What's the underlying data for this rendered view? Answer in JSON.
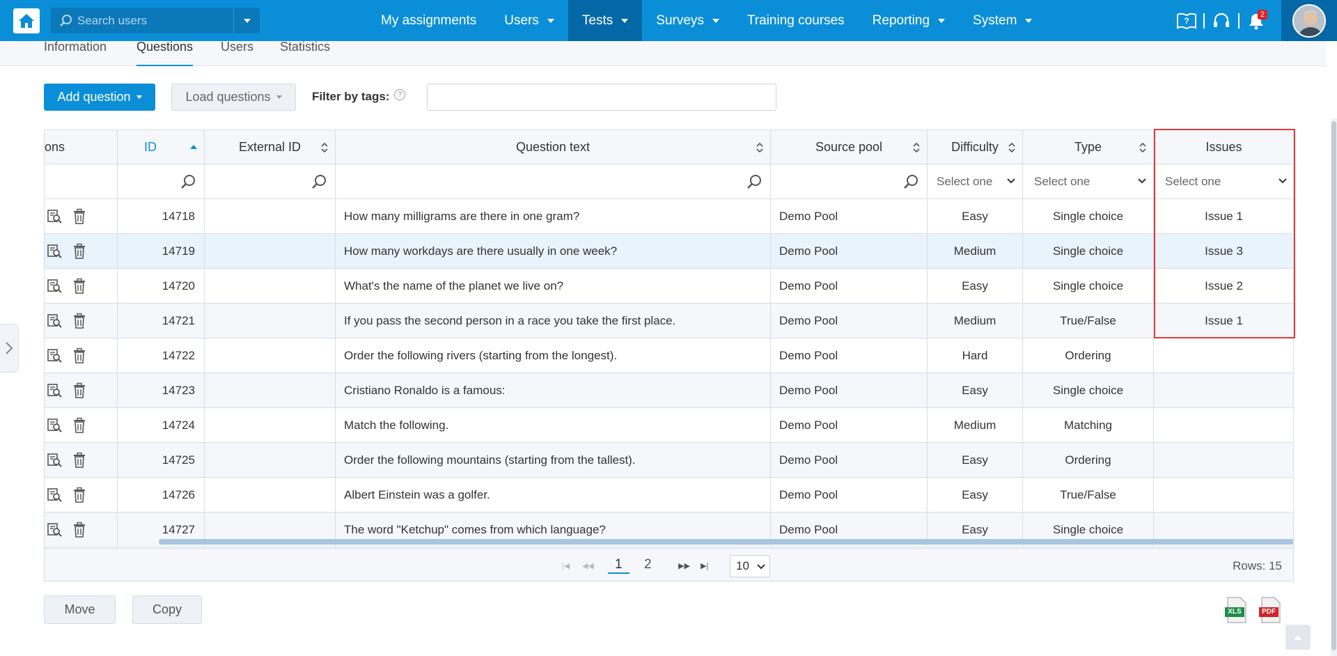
{
  "nav": {
    "search_placeholder": "Search users",
    "items": [
      {
        "label": "My assignments",
        "has_caret": false,
        "active": false
      },
      {
        "label": "Users",
        "has_caret": true,
        "active": false
      },
      {
        "label": "Tests",
        "has_caret": true,
        "active": true
      },
      {
        "label": "Surveys",
        "has_caret": true,
        "active": false
      },
      {
        "label": "Training courses",
        "has_caret": false,
        "active": false
      },
      {
        "label": "Reporting",
        "has_caret": true,
        "active": false
      },
      {
        "label": "System",
        "has_caret": true,
        "active": false
      }
    ],
    "notification_count": "2",
    "brand_color": "#0b8ed8"
  },
  "tabs": {
    "information": "Information",
    "questions": "Questions",
    "users": "Users",
    "statistics": "Statistics"
  },
  "toolbar": {
    "add_question": "Add question",
    "load_questions": "Load questions",
    "filter_label": "Filter by tags:",
    "help_glyph": "?"
  },
  "table": {
    "headers": {
      "actions": "ons",
      "id": "ID",
      "external_id": "External ID",
      "question_text": "Question text",
      "source_pool": "Source pool",
      "difficulty": "Difficulty",
      "type": "Type",
      "issues": "Issues"
    },
    "filters": {
      "difficulty": "Select one",
      "type": "Select one",
      "issues": "Select one"
    },
    "rows": [
      {
        "id": "14718",
        "external_id": "",
        "text": "How many milligrams are there in one gram?",
        "pool": "Demo Pool",
        "difficulty": "Easy",
        "type": "Single choice",
        "issue": "Issue 1"
      },
      {
        "id": "14719",
        "external_id": "",
        "text": "How many workdays are there usually in one week?",
        "pool": "Demo Pool",
        "difficulty": "Medium",
        "type": "Single choice",
        "issue": "Issue 3"
      },
      {
        "id": "14720",
        "external_id": "",
        "text": "What's the name of the planet we live on?",
        "pool": "Demo Pool",
        "difficulty": "Easy",
        "type": "Single choice",
        "issue": "Issue 2"
      },
      {
        "id": "14721",
        "external_id": "",
        "text": "If you pass the second person in a race you take the first place.",
        "pool": "Demo Pool",
        "difficulty": "Medium",
        "type": "True/False",
        "issue": "Issue 1"
      },
      {
        "id": "14722",
        "external_id": "",
        "text": "Order the following rivers (starting from the longest).",
        "pool": "Demo Pool",
        "difficulty": "Hard",
        "type": "Ordering",
        "issue": ""
      },
      {
        "id": "14723",
        "external_id": "",
        "text": "Cristiano Ronaldo is a famous:",
        "pool": "Demo Pool",
        "difficulty": "Easy",
        "type": "Single choice",
        "issue": ""
      },
      {
        "id": "14724",
        "external_id": "",
        "text": "Match the following.",
        "pool": "Demo Pool",
        "difficulty": "Medium",
        "type": "Matching",
        "issue": ""
      },
      {
        "id": "14725",
        "external_id": "",
        "text": "Order the following mountains (starting from the tallest).",
        "pool": "Demo Pool",
        "difficulty": "Easy",
        "type": "Ordering",
        "issue": ""
      },
      {
        "id": "14726",
        "external_id": "",
        "text": "Albert Einstein was a golfer.",
        "pool": "Demo Pool",
        "difficulty": "Easy",
        "type": "True/False",
        "issue": ""
      },
      {
        "id": "14727",
        "external_id": "",
        "text": "The word \"Ketchup\" comes from which language?",
        "pool": "Demo Pool",
        "difficulty": "Easy",
        "type": "Single choice",
        "issue": ""
      }
    ]
  },
  "pagination": {
    "pages": [
      "1",
      "2"
    ],
    "current": "1",
    "page_size": "10",
    "rows_label": "Rows: 15"
  },
  "bottom": {
    "move": "Move",
    "copy": "Copy",
    "xls_label": "XLS",
    "pdf_label": "PDF"
  }
}
